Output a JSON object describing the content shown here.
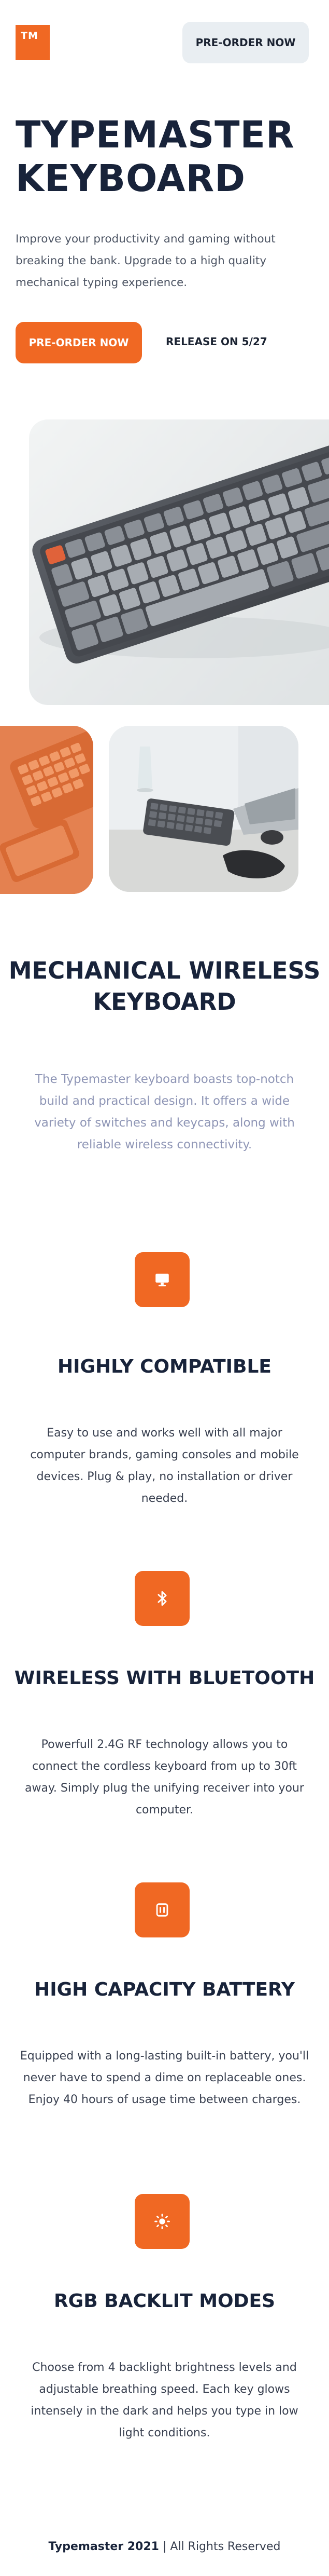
{
  "header": {
    "logo_text": "TM",
    "preorder_label": "PRE-ORDER NOW"
  },
  "hero": {
    "title": "TYPEMASTER KEYBOARD",
    "description": "Improve your productivity and gaming without breaking the bank. Upgrade to a high quality mechanical typing experience.",
    "cta_label": "PRE-ORDER NOW",
    "release_label": "RELEASE ON 5/27"
  },
  "intro": {
    "title": "MECHANICAL WIRELESS KEYBOARD",
    "description": "The Typemaster keyboard boasts top-notch build and practical design. It offers a wide variety of switches and keycaps, along with reliable wireless connectivity."
  },
  "features": [
    {
      "icon": "monitor-icon",
      "title": "HIGHLY COMPATIBLE",
      "description": "Easy to use and works well with all major computer brands, gaming consoles and mobile devices. Plug & play, no installation or driver needed."
    },
    {
      "icon": "bluetooth-icon",
      "title": "WIRELESS WITH BLUETOOTH",
      "description": "Powerfull 2.4G RF technology allows you to connect the cordless keyboard from up to 30ft away. Simply plug the unifying receiver into your computer."
    },
    {
      "icon": "battery-icon",
      "title": "HIGH CAPACITY BATTERY",
      "description": "Equipped with a long-lasting built-in battery, you'll never have to spend a dime on replaceable ones. Enjoy 40 hours of usage time between charges."
    },
    {
      "icon": "brightness-icon",
      "title": "RGB BACKLIT MODES",
      "description": "Choose from 4 backlight brightness levels and adjustable breathing speed. Each key glows intensely in the dark and helps you type in low light conditions."
    }
  ],
  "footer": {
    "brand": "Typemaster 2021",
    "separator": " | ",
    "rights": "All Rights Reserved"
  },
  "colors": {
    "accent": "#f06823",
    "heading": "#18233a",
    "muted": "#8f96b6"
  }
}
